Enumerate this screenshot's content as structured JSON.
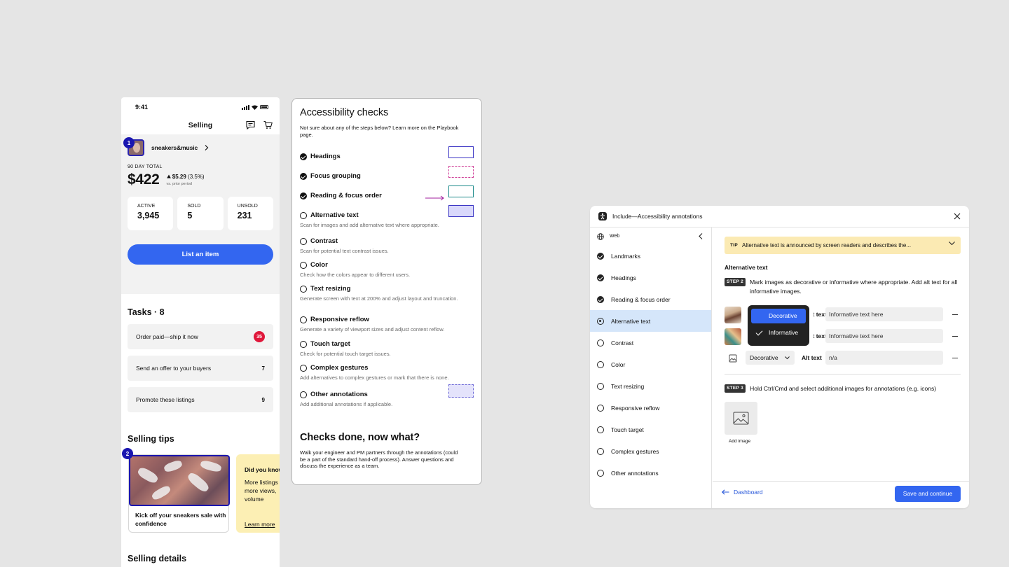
{
  "phone": {
    "time": "9:41",
    "title": "Selling",
    "seller_name": "sneakers&music",
    "annotation_1": "1",
    "annotation_2": "2",
    "total_label": "90 DAY TOTAL",
    "total_amount": "$422",
    "delta_value": "$5.29",
    "delta_pct": "(3.5%)",
    "delta_note": "vs. prior period",
    "stats": [
      {
        "label": "ACTIVE",
        "value": "3,945"
      },
      {
        "label": "SOLD",
        "value": "5"
      },
      {
        "label": "UNSOLD",
        "value": "231"
      }
    ],
    "list_button": "List an item",
    "tasks_heading": "Tasks · 8",
    "tasks": [
      {
        "label": "Order paid—ship it now",
        "count": "35"
      },
      {
        "label": "Send an offer to your buyers",
        "count": "7"
      },
      {
        "label": "Promote these listings",
        "count": "9"
      }
    ],
    "tips_heading": "Selling tips",
    "tip_card": "Kick off your sneakers sale with confidence",
    "tip2_title": "Did you know",
    "tip2_body": "More listings more views, volume",
    "tip2_link": "Learn more",
    "details_heading": "Selling details"
  },
  "checks": {
    "title": "Accessibility checks",
    "intro": "Not sure about any of the steps below? Learn more on the Playbook page.",
    "items": [
      {
        "label": "Headings",
        "done": true,
        "desc": ""
      },
      {
        "label": "Focus grouping",
        "done": true,
        "desc": ""
      },
      {
        "label": "Reading & focus order",
        "done": true,
        "desc": ""
      },
      {
        "label": "Alternative text",
        "done": false,
        "desc": "Scan for images and add alternative text where appropriate."
      },
      {
        "label": "Contrast",
        "done": false,
        "desc": "Scan for potential text contrast issues."
      },
      {
        "label": "Color",
        "done": false,
        "desc": "Check how the colors appear to different users."
      },
      {
        "label": "Text resizing",
        "done": false,
        "desc": "Generate screen with text at 200% and adjust layout and truncation."
      },
      {
        "label": "Responsive reflow",
        "done": false,
        "desc": "Generate a variety of viewport sizes and adjust content reflow."
      },
      {
        "label": "Touch target",
        "done": false,
        "desc": "Check for potential touch target issues."
      },
      {
        "label": "Complex gestures",
        "done": false,
        "desc": "Add alternatives to complex gestures or mark that there is none."
      },
      {
        "label": "Other annotations",
        "done": false,
        "desc": "Add additional annotations if applicable."
      }
    ],
    "done_title": "Checks done, now what?",
    "done_body": "Walk your engineer and PM partners through the annotations (could be a part of the standard hand-off process). Answer questions and discuss the experience as a team."
  },
  "dialog": {
    "title": "Include—Accessibility annotations",
    "platform": "Web",
    "nav": [
      {
        "label": "Landmarks",
        "state": "done"
      },
      {
        "label": "Headings",
        "state": "done"
      },
      {
        "label": "Reading & focus order",
        "state": "done"
      },
      {
        "label": "Alternative text",
        "state": "active"
      },
      {
        "label": "Contrast",
        "state": "todo"
      },
      {
        "label": "Color",
        "state": "todo"
      },
      {
        "label": "Text resizing",
        "state": "todo"
      },
      {
        "label": "Responsive reflow",
        "state": "todo"
      },
      {
        "label": "Touch target",
        "state": "todo"
      },
      {
        "label": "Complex gestures",
        "state": "todo"
      },
      {
        "label": "Other annotations",
        "state": "todo"
      }
    ],
    "tip_tag": "TIP",
    "tip_text": "Alternative text is announced by screen readers and describes the...",
    "section_title": "Alternative text",
    "step2_label": "STEP 2",
    "step2_text": "Mark images as decorative or informative where appropriate. Add alt text for all informative images.",
    "rows": [
      {
        "alt_label": "Alt text",
        "alt_placeholder": "Informative text here"
      },
      {
        "alt_label": "Alt text",
        "alt_placeholder": "Informative text here"
      },
      {
        "select_value": "Decorative",
        "alt_label": "Alt text",
        "alt_value": "n/a"
      }
    ],
    "dropdown_options": [
      "Decorative",
      "Informative"
    ],
    "step3_label": "STEP 3",
    "step3_text": "Hold Ctrl/Cmd and select additional images for annotations (e.g. icons)",
    "add_image": "Add image",
    "back_link": "Dashboard",
    "save_button": "Save and continue",
    "colors": {
      "accent": "#3366f0",
      "tip_bg": "#fbeab3",
      "active_nav": "#d5e6fa",
      "annotation": "#1a16b0"
    }
  }
}
